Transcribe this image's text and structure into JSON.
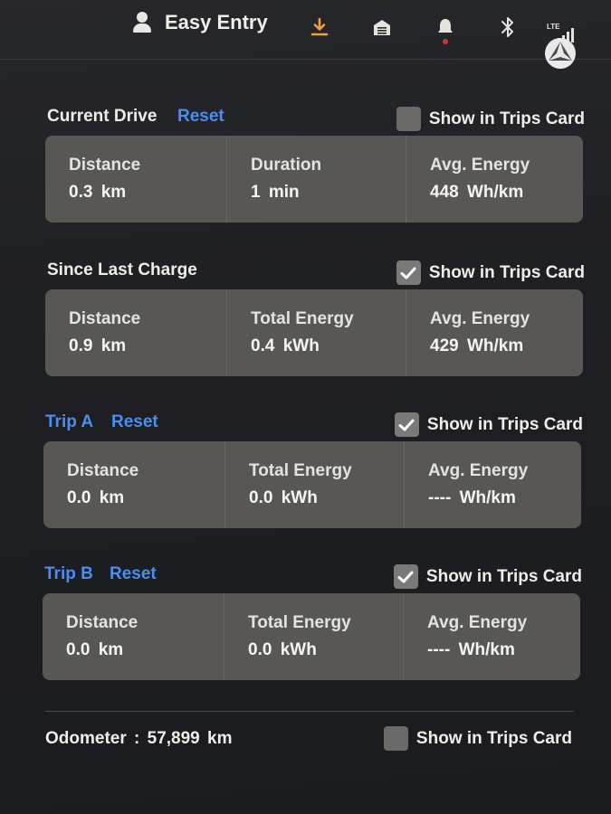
{
  "status_bar": {
    "profile_name": "Easy Entry",
    "icons": [
      "person-icon",
      "download-icon",
      "garage-icon",
      "bell-icon",
      "bluetooth-icon",
      "lte-signal-icon",
      "avatar"
    ],
    "lte_label": "LTE",
    "download_color": "#f0a23a",
    "alert_dot_color": "#e0302a"
  },
  "accent_color": "#4a8ef2",
  "sections": [
    {
      "title": "Current Drive",
      "reset_label": "Reset",
      "show_label": "Show in Trips Card",
      "show_checked": false,
      "cells": [
        {
          "label": "Distance",
          "value": "0.3  km"
        },
        {
          "label": "Duration",
          "value": "1  min"
        },
        {
          "label": "Avg. Energy",
          "value": "448  Wh/km"
        }
      ]
    },
    {
      "title": "Since Last Charge",
      "show_label": "Show in Trips Card",
      "show_checked": true,
      "cells": [
        {
          "label": "Distance",
          "value": "0.9  km"
        },
        {
          "label": "Total Energy",
          "value": "0.4  kWh"
        },
        {
          "label": "Avg. Energy",
          "value": "429  Wh/km"
        }
      ]
    },
    {
      "title": "Trip A",
      "reset_label": "Reset",
      "show_label": "Show in Trips Card",
      "show_checked": true,
      "cells": [
        {
          "label": "Distance",
          "value": "0.0  km"
        },
        {
          "label": "Total Energy",
          "value": "0.0  kWh"
        },
        {
          "label": "Avg. Energy",
          "value": "----  Wh/km"
        }
      ]
    },
    {
      "title": "Trip B",
      "reset_label": "Reset",
      "show_label": "Show in Trips Card",
      "show_checked": true,
      "cells": [
        {
          "label": "Distance",
          "value": "0.0  km"
        },
        {
          "label": "Total Energy",
          "value": "0.0  kWh"
        },
        {
          "label": "Avg. Energy",
          "value": "----  Wh/km"
        }
      ]
    }
  ],
  "odometer": {
    "text": "Odometer  :  57,899  km",
    "show_label": "Show in Trips Card",
    "show_checked": false
  }
}
